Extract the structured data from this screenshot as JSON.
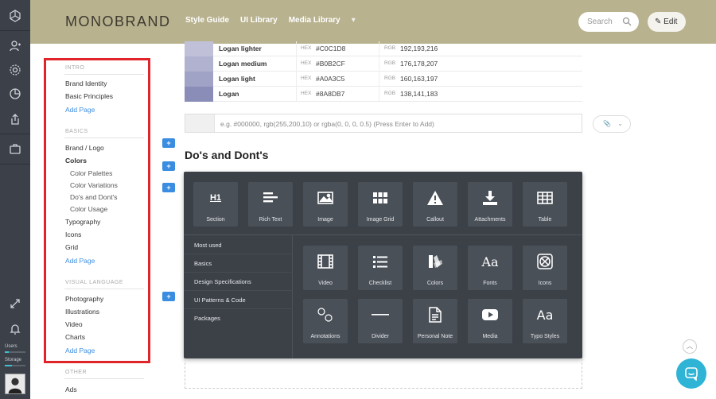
{
  "header": {
    "logo": "MONOBRAND",
    "nav": [
      "Style Guide",
      "UI Library",
      "Media Library"
    ],
    "nav_more": "▾",
    "search_placeholder": "Search",
    "edit_label": "Edit"
  },
  "rail": {
    "users_label": "Users",
    "storage_label": "Storage",
    "users_fill": 0.2,
    "storage_fill": 0.35
  },
  "sidebar": {
    "sections": [
      {
        "label": "INTRO",
        "items": [
          {
            "label": "Brand Identity"
          },
          {
            "label": "Basic Principles"
          }
        ],
        "add": "Add Page"
      },
      {
        "label": "BASICS",
        "items": [
          {
            "label": "Brand / Logo"
          },
          {
            "label": "Colors",
            "active": true
          },
          {
            "label": "Color Palettes",
            "sub": true
          },
          {
            "label": "Color Variations",
            "sub": true
          },
          {
            "label": "Do's and Dont's",
            "sub": true
          },
          {
            "label": "Color Usage",
            "sub": true
          },
          {
            "label": "Typography"
          },
          {
            "label": "Icons"
          },
          {
            "label": "Grid"
          }
        ],
        "add": "Add Page"
      },
      {
        "label": "VISUAL LANGUAGE",
        "items": [
          {
            "label": "Photography"
          },
          {
            "label": "Illustrations"
          },
          {
            "label": "Video"
          },
          {
            "label": "Charts"
          }
        ],
        "add": "Add Page"
      },
      {
        "label": "OTHER",
        "items": [
          {
            "label": "Ads"
          }
        ]
      }
    ]
  },
  "colors": [
    {
      "name": "Logan lighter",
      "hex": "#C0C1D8",
      "rgb": "192,193,216",
      "swatch": "#c0c1d8"
    },
    {
      "name": "Logan medium",
      "hex": "#B0B2CF",
      "rgb": "176,178,207",
      "swatch": "#b0b2cf"
    },
    {
      "name": "Logan light",
      "hex": "#A0A3C5",
      "rgb": "160,163,197",
      "swatch": "#a0a3c5"
    },
    {
      "name": "Logan",
      "hex": "#8A8DB7",
      "rgb": "138,141,183",
      "swatch": "#8a8db7"
    }
  ],
  "color_labels": {
    "hex": "HEX",
    "rgb": "RGB"
  },
  "add_color_placeholder": "e.g. #000000, rgb(255,200,10) or rgba(0, 0, 0, 0.5) (Press Enter to Add)",
  "section_title": "Do's and Dont's",
  "insert_panel": {
    "top_tiles": [
      {
        "label": "Section",
        "icon": "heading-icon",
        "glyph": "H1"
      },
      {
        "label": "Rich Text",
        "icon": "text-lines-icon"
      },
      {
        "label": "Image",
        "icon": "image-icon"
      },
      {
        "label": "Image Grid",
        "icon": "grid-icon"
      },
      {
        "label": "Callout",
        "icon": "warning-icon"
      },
      {
        "label": "Attachments",
        "icon": "download-icon"
      },
      {
        "label": "Table",
        "icon": "table-icon"
      }
    ],
    "categories": [
      "Most used",
      "Basics",
      "Design Specifications",
      "UI Patterns & Code",
      "Packages"
    ],
    "grid_tiles": [
      {
        "label": "Video",
        "icon": "film-icon"
      },
      {
        "label": "Checklist",
        "icon": "checklist-icon"
      },
      {
        "label": "Colors",
        "icon": "palette-icon"
      },
      {
        "label": "Fonts",
        "icon": "fonts-icon",
        "glyph": "Aa"
      },
      {
        "label": "Icons",
        "icon": "icons-icon"
      },
      {
        "label": "Annotations",
        "icon": "annotations-icon"
      },
      {
        "label": "Divider",
        "icon": "divider-icon"
      },
      {
        "label": "Personal Note",
        "icon": "note-icon"
      },
      {
        "label": "Media",
        "icon": "play-icon"
      },
      {
        "label": "Typo Styles",
        "icon": "typo-icon",
        "glyph": "Aa"
      }
    ]
  },
  "colors_theme": {
    "accent": "#3a8de0",
    "header": "#b8b28f",
    "highlight": "#e0242a",
    "panel": "#3c4148"
  }
}
